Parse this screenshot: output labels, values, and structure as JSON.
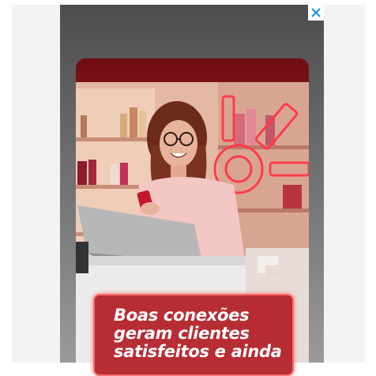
{
  "ad": {
    "close_icon": "close-x-icon",
    "headline_lines": [
      "Boas conexões",
      "geram clientes",
      "satisfeitos e ainda"
    ],
    "colors": {
      "brand_red": "#b21c24",
      "neon_red": "#ff4b55",
      "close_blue": "#1a8fd6"
    }
  }
}
